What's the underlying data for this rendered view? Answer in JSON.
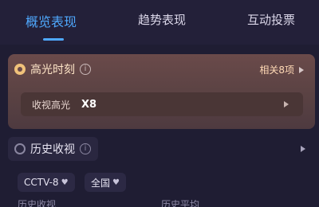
{
  "tabs": [
    {
      "label": "概览表现",
      "active": true
    },
    {
      "label": "趋势表现",
      "active": false
    },
    {
      "label": "互动投票",
      "active": false
    }
  ],
  "highlight": {
    "title": "高光时刻",
    "info": "i",
    "related": "相关8项",
    "row_label": "收视高光",
    "row_value": "X8"
  },
  "history": {
    "title": "历史收视",
    "info": "i",
    "filters": [
      "CCTV-8",
      "全国"
    ],
    "labels": [
      "历史收视",
      "历史平均"
    ]
  },
  "colors": {
    "accent": "#4fa9ff",
    "background": "#1f1d33",
    "card": "#5a4243"
  }
}
